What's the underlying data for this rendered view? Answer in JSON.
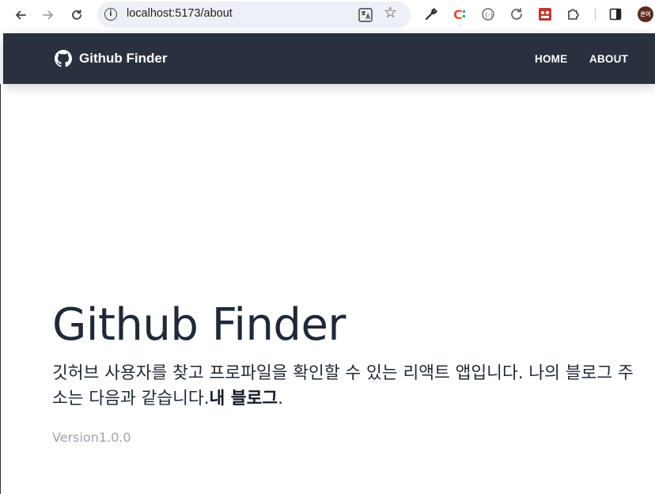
{
  "browser": {
    "url": "localhost:5173/about",
    "profile_initials": "은이"
  },
  "navbar": {
    "brand": "Github Finder",
    "links": [
      {
        "label": "HOME"
      },
      {
        "label": "ABOUT"
      }
    ],
    "background": "#2a313e"
  },
  "hero": {
    "title": "Github Finder",
    "description": "깃허브 사용자를 찾고 프로파일을 확인할 수 있는 리액트 앱입니다. 나의 블로그 주소는 다음과 같습니다.",
    "blog_link": "내 블로그",
    "trailing": ".",
    "version": "Version1.0.0"
  },
  "icons": {
    "back": "arrow-left-icon",
    "forward": "arrow-right-icon",
    "reload": "reload-icon",
    "info": "info-icon",
    "translate": "translate-icon",
    "bookmark": "star-icon",
    "brand": "github-icon"
  }
}
